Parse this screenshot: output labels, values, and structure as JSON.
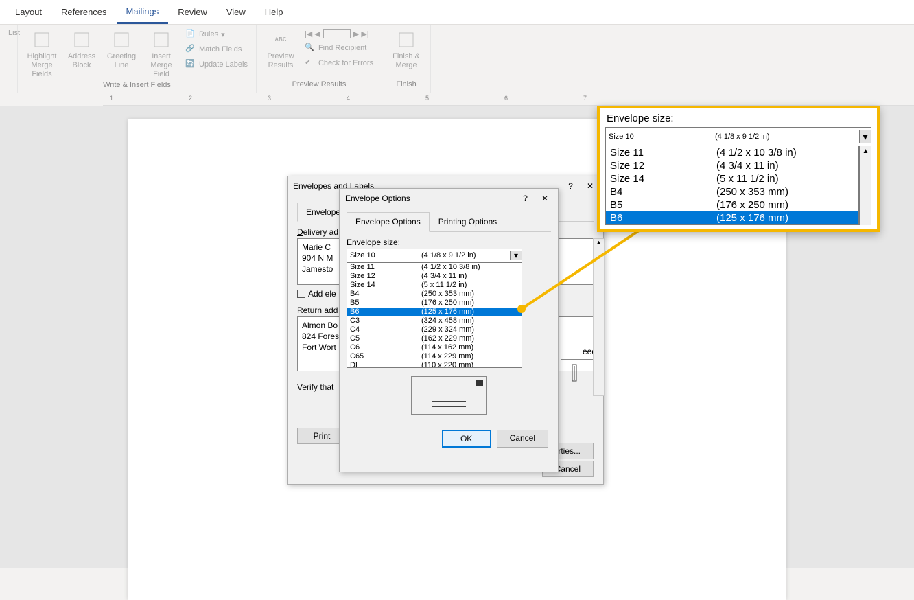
{
  "tabs": {
    "layout": "Layout",
    "references": "References",
    "mailings": "Mailings",
    "review": "Review",
    "view": "View",
    "help": "Help"
  },
  "ribbon": {
    "list": "List",
    "highlight": "Highlight Merge Fields",
    "address": "Address Block",
    "greeting": "Greeting Line",
    "insert_merge": "Insert Merge Field",
    "rules": "Rules",
    "match": "Match Fields",
    "update": "Update Labels",
    "group_write": "Write & Insert Fields",
    "preview": "Preview Results",
    "find": "Find Recipient",
    "check": "Check for Errors",
    "group_preview": "Preview Results",
    "finish": "Finish & Merge",
    "group_finish": "Finish"
  },
  "envdlg": {
    "title": "Envelopes and Labels",
    "tab_env": "Envelopes",
    "delivery": "Delivery ad",
    "delivery_text": "Marie C\n904 N M\nJamesto",
    "add_ele": "Add ele",
    "return": "Return add",
    "return_text": "Almon Bo\n824 Fores\nFort Wort",
    "verify": "Verify that",
    "print": "Print",
    "prop": "perties...",
    "cancel": "Cancel",
    "feed": "eed"
  },
  "optdlg": {
    "title": "Envelope Options",
    "tab_opt": "Envelope Options",
    "tab_print": "Printing Options",
    "size_label": "Envelope size:",
    "combo_sel_name": "Size 10",
    "combo_sel_dim": "(4 1/8 x 9 1/2 in)",
    "sizes": [
      {
        "name": "Size 11",
        "dim": "(4 1/2 x 10 3/8 in)"
      },
      {
        "name": "Size 12",
        "dim": "(4 3/4 x 11 in)"
      },
      {
        "name": "Size 14",
        "dim": "(5 x 11 1/2 in)"
      },
      {
        "name": "B4",
        "dim": "(250 x 353 mm)"
      },
      {
        "name": "B5",
        "dim": "(176 x 250 mm)"
      },
      {
        "name": "B6",
        "dim": "(125 x 176 mm)"
      },
      {
        "name": "C3",
        "dim": "(324 x 458 mm)"
      },
      {
        "name": "C4",
        "dim": "(229 x 324 mm)"
      },
      {
        "name": "C5",
        "dim": "(162 x 229 mm)"
      },
      {
        "name": "C6",
        "dim": "(114 x 162 mm)"
      },
      {
        "name": "C65",
        "dim": "(114 x 229 mm)"
      },
      {
        "name": "DL",
        "dim": "(110 x 220 mm)"
      }
    ],
    "selected_index": 5,
    "ok": "OK",
    "cancel": "Cancel"
  },
  "callout": {
    "label": "Envelope size:",
    "combo_sel_name": "Size 10",
    "combo_sel_dim": "(4 1/8 x 9 1/2 in)",
    "sizes": [
      {
        "name": "Size 11",
        "dim": "(4 1/2 x 10 3/8 in)"
      },
      {
        "name": "Size 12",
        "dim": "(4 3/4 x 11 in)"
      },
      {
        "name": "Size 14",
        "dim": "(5 x 11 1/2 in)"
      },
      {
        "name": "B4",
        "dim": "(250 x 353 mm)"
      },
      {
        "name": "B5",
        "dim": "(176 x 250 mm)"
      },
      {
        "name": "B6",
        "dim": "(125 x 176 mm)"
      }
    ],
    "selected_index": 5
  },
  "ruler_marks": [
    "1",
    "2",
    "3",
    "4",
    "5",
    "6",
    "7"
  ]
}
